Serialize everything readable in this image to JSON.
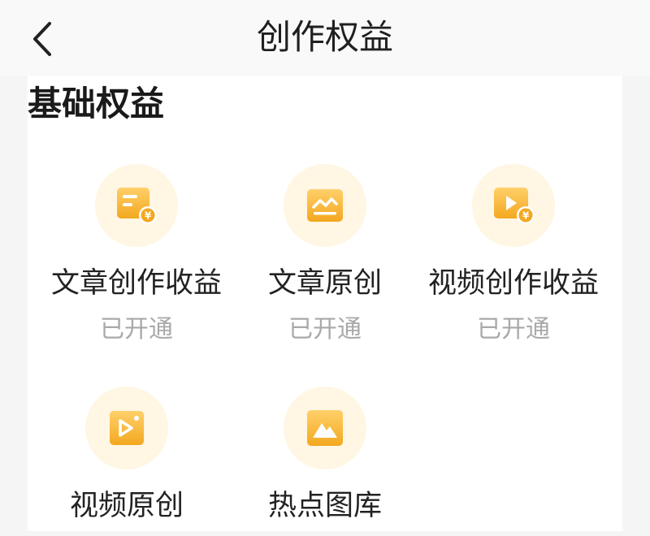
{
  "header": {
    "title": "创作权益"
  },
  "section": {
    "title": "基础权益"
  },
  "benefits": [
    {
      "label": "文章创作收益",
      "status": "已开通",
      "icon": "article-income-icon"
    },
    {
      "label": "文章原创",
      "status": "已开通",
      "icon": "article-original-icon"
    },
    {
      "label": "视频创作收益",
      "status": "已开通",
      "icon": "video-income-icon"
    },
    {
      "label": "视频原创",
      "status": "",
      "icon": "video-original-icon"
    },
    {
      "label": "热点图库",
      "status": "",
      "icon": "hot-gallery-icon"
    }
  ],
  "colors": {
    "icon_gradient_top": "#ffd06a",
    "icon_gradient_bottom": "#f3a81f",
    "icon_bg": "#fff6e3",
    "status_gray": "#a9a9a9"
  }
}
